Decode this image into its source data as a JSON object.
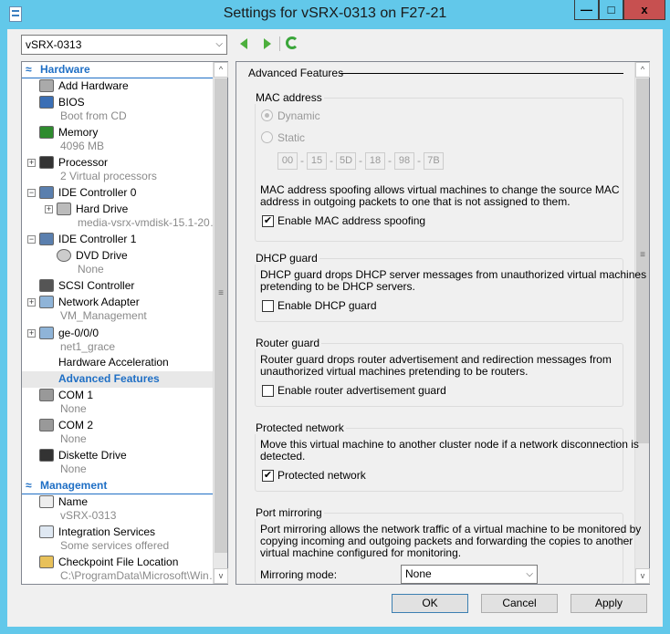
{
  "window": {
    "title": "Settings for vSRX-0313 on F27-21",
    "minimize": "—",
    "maximize": "□",
    "close": "x"
  },
  "vm_selector": {
    "value": "vSRX-0313"
  },
  "tree": [
    {
      "label": "Hardware",
      "type": "header"
    },
    {
      "label": "Add Hardware",
      "icon": "add-hardware-icon"
    },
    {
      "label": "BIOS",
      "icon": "bios-icon",
      "sub": "Boot from CD"
    },
    {
      "label": "Memory",
      "icon": "memory-icon",
      "sub": "4096 MB"
    },
    {
      "label": "Processor",
      "icon": "processor-icon",
      "sub": "2 Virtual processors",
      "expand": "+"
    },
    {
      "label": "IDE Controller 0",
      "icon": "ide-controller-icon",
      "expand": "−"
    },
    {
      "label": "Hard Drive",
      "icon": "hard-drive-icon",
      "sub": "media-vsrx-vmdisk-15.1-20…",
      "expand": "+",
      "indent": 1
    },
    {
      "label": "IDE Controller 1",
      "icon": "ide-controller-icon",
      "expand": "−"
    },
    {
      "label": "DVD Drive",
      "icon": "dvd-drive-icon",
      "sub": "None",
      "indent": 1
    },
    {
      "label": "SCSI Controller",
      "icon": "scsi-controller-icon"
    },
    {
      "label": "Network Adapter",
      "icon": "network-adapter-icon",
      "sub": "VM_Management",
      "expand": "+"
    },
    {
      "label": "ge-0/0/0",
      "icon": "network-adapter-icon",
      "sub": "net1_grace",
      "expand": "+"
    },
    {
      "label": "Hardware Acceleration",
      "child": true
    },
    {
      "label": "Advanced Features",
      "child": true,
      "selected": true
    },
    {
      "label": "COM 1",
      "icon": "com-port-icon",
      "sub": "None"
    },
    {
      "label": "COM 2",
      "icon": "com-port-icon",
      "sub": "None"
    },
    {
      "label": "Diskette Drive",
      "icon": "diskette-icon",
      "sub": "None"
    },
    {
      "label": "Management",
      "type": "header"
    },
    {
      "label": "Name",
      "icon": "name-icon",
      "sub": "vSRX-0313"
    },
    {
      "label": "Integration Services",
      "icon": "integration-services-icon",
      "sub": "Some services offered"
    },
    {
      "label": "Checkpoint File Location",
      "icon": "checkpoint-folder-icon",
      "sub": "C:\\ProgramData\\Microsoft\\Win…"
    }
  ],
  "details": {
    "heading": "Advanced Features",
    "mac": {
      "title": "MAC address",
      "dynamic": "Dynamic",
      "static": "Static",
      "octets": [
        "00",
        "15",
        "5D",
        "18",
        "98",
        "7B"
      ],
      "desc1": "MAC address spoofing allows virtual machines to change the source MAC",
      "desc2": "address in outgoing packets to one that is not assigned to them.",
      "spoof_label": "Enable MAC address spoofing",
      "spoof_checked": true
    },
    "dhcp": {
      "title": "DHCP guard",
      "desc1": "DHCP guard drops DHCP server messages from unauthorized virtual machines",
      "desc2": "pretending to be DHCP servers.",
      "label": "Enable DHCP guard",
      "checked": false
    },
    "router": {
      "title": "Router guard",
      "desc1": "Router guard drops router advertisement and redirection messages from",
      "desc2": "unauthorized virtual machines pretending to be routers.",
      "label": "Enable router advertisement guard",
      "checked": false
    },
    "protected": {
      "title": "Protected network",
      "desc1": "Move this virtual machine to another cluster node if a network disconnection is",
      "desc2": "detected.",
      "label": "Protected network",
      "checked": true
    },
    "mirror": {
      "title": "Port mirroring",
      "desc1": "Port mirroring allows the network traffic of a virtual machine to be monitored by",
      "desc2": "copying incoming and outgoing packets and forwarding the copies to another",
      "desc3": "virtual machine configured for monitoring.",
      "mode_label": "Mirroring mode:",
      "mode_value": "None"
    }
  },
  "buttons": {
    "ok": "OK",
    "cancel": "Cancel",
    "apply": "Apply"
  },
  "colors": {
    "titlebar": "#62c8ea",
    "close": "#c75050",
    "accent": "#1f6fc5"
  }
}
